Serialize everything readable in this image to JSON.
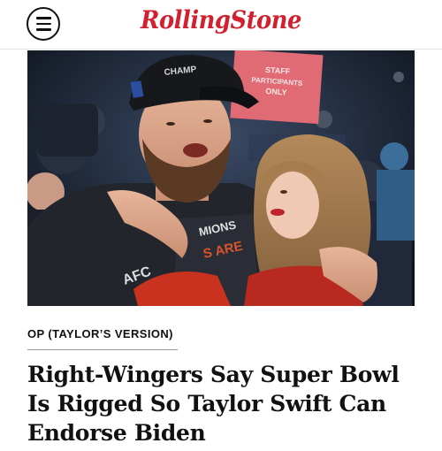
{
  "header": {
    "menu_icon": "hamburger-menu-icon",
    "logo_text": "RollingStone",
    "logo_color": "#d3202f"
  },
  "hero": {
    "sign_text_line1": "STAFF",
    "sign_text_line2": "PARTICIPANTS",
    "sign_text_line3": "ONLY",
    "cap_text": "CHAMP",
    "shirt_text_1": "AFC",
    "shirt_text_2": "MIONS",
    "shirt_text_3": "S ARE"
  },
  "article": {
    "kicker": "OP (TAYLOR’S VERSION)",
    "headline_line1": "Right-Wingers Say Super Bowl",
    "headline_line2": "Is Rigged So Taylor Swift Can",
    "headline_line3": "Endorse Biden"
  }
}
